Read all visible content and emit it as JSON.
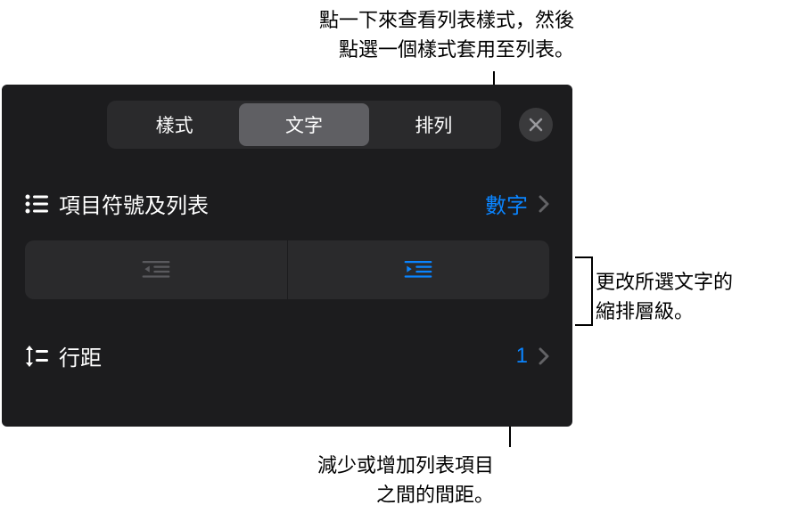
{
  "callouts": {
    "top_line1": "點一下來查看列表樣式，然後",
    "top_line2": "點選一個樣式套用至列表。",
    "right_line1": "更改所選文字的",
    "right_line2": "縮排層級。",
    "bottom_line1": "減少或增加列表項目",
    "bottom_line2": "之間的間距。"
  },
  "tabs": {
    "style": "樣式",
    "text": "文字",
    "arrange": "排列"
  },
  "rows": {
    "bullets_label": "項目符號及列表",
    "bullets_value": "數字",
    "linespacing_label": "行距",
    "linespacing_value": "1"
  },
  "colors": {
    "accent": "#0a84ff",
    "panel_bg": "#1c1c1e",
    "seg_bg": "#2a2a2c",
    "seg_active": "#5f5f63"
  }
}
